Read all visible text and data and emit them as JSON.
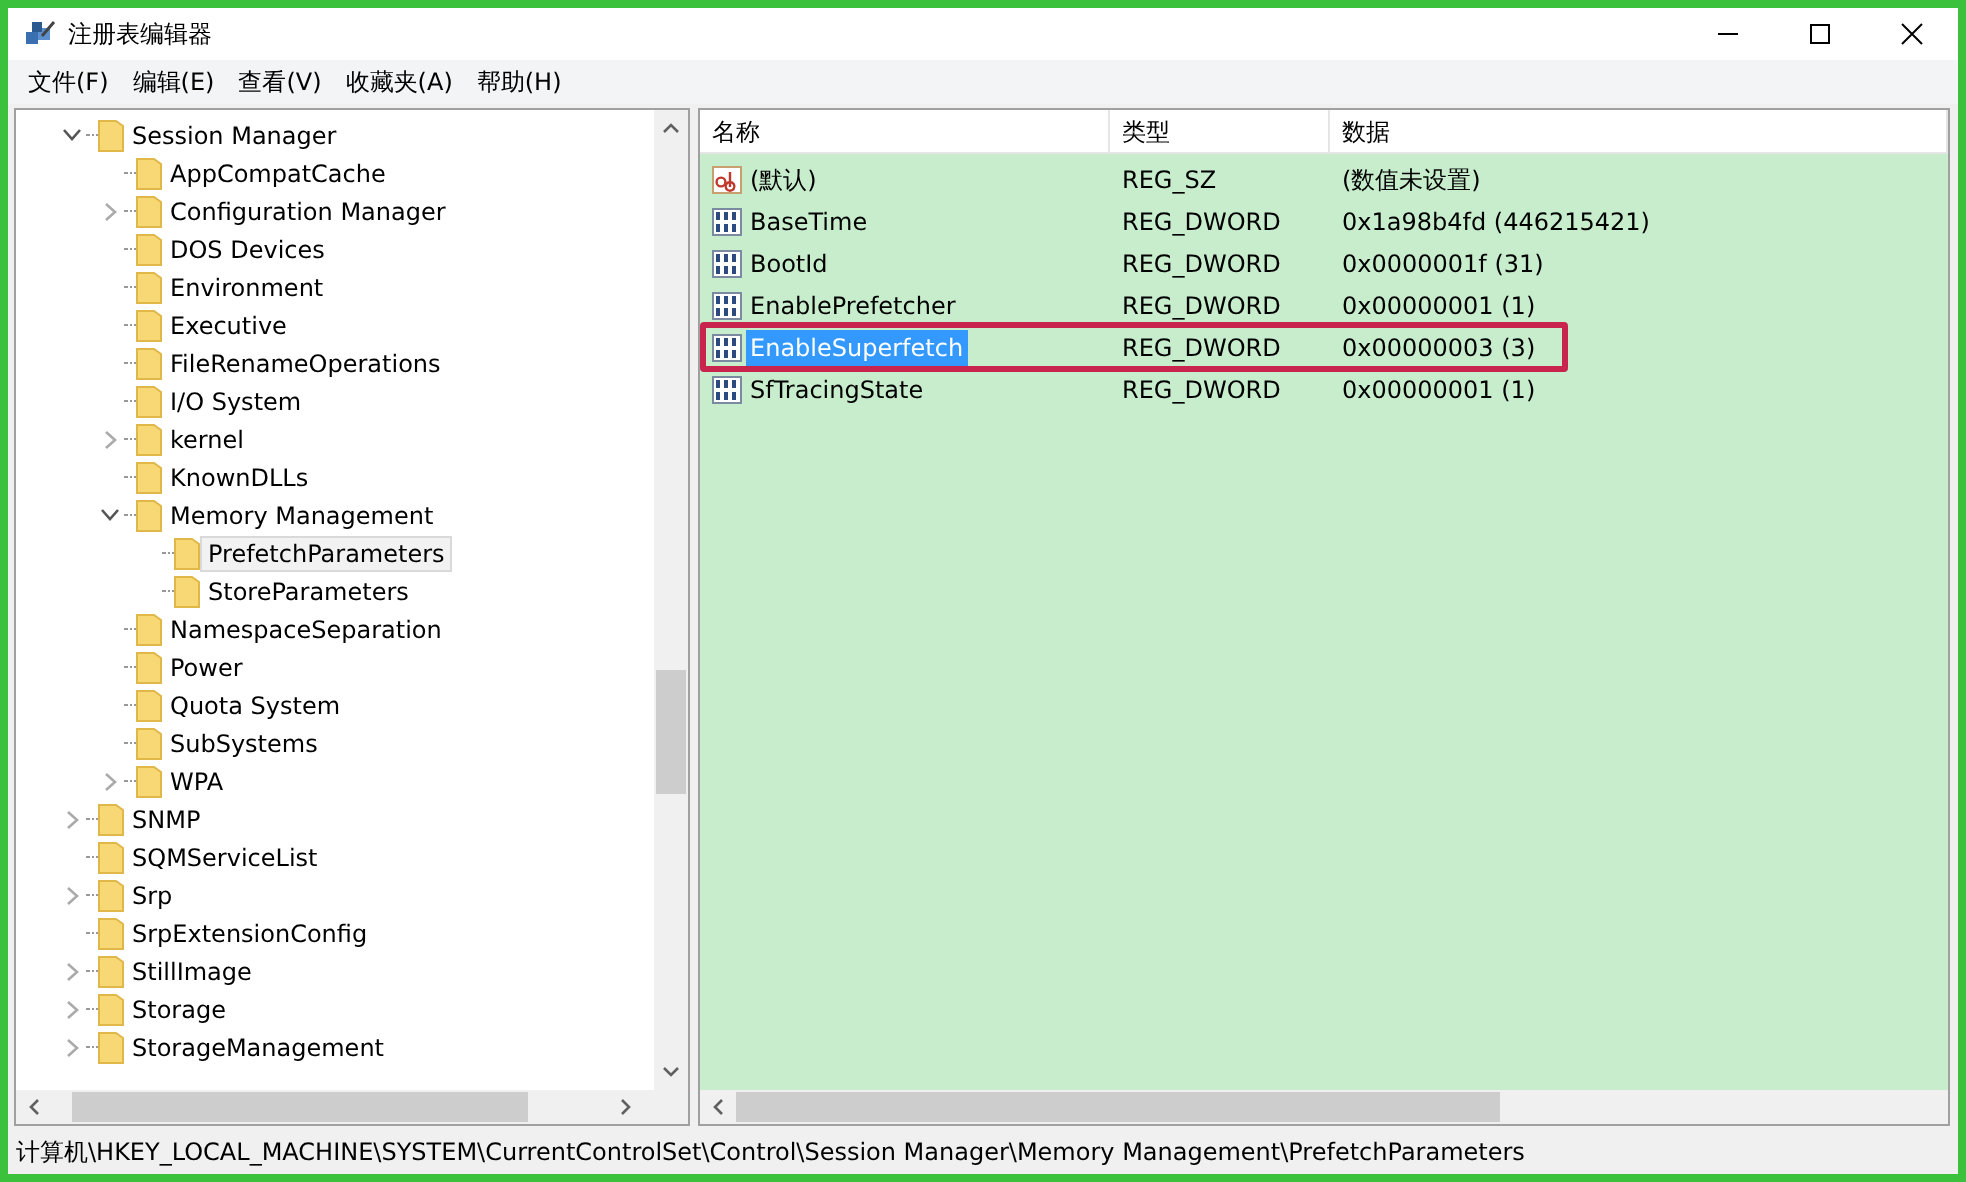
{
  "window": {
    "title": "注册表编辑器"
  },
  "menu": [
    "文件(F)",
    "编辑(E)",
    "查看(V)",
    "收藏夹(A)",
    "帮助(H)"
  ],
  "tree": [
    {
      "label": "Session Manager",
      "expanded": true,
      "selected": false,
      "children": [
        {
          "label": "AppCompatCache",
          "selected": false
        },
        {
          "label": "Configuration Manager",
          "expanded": false,
          "selected": false
        },
        {
          "label": "DOS Devices",
          "selected": false
        },
        {
          "label": "Environment",
          "selected": false
        },
        {
          "label": "Executive",
          "selected": false
        },
        {
          "label": "FileRenameOperations",
          "selected": false
        },
        {
          "label": "I/O System",
          "selected": false
        },
        {
          "label": "kernel",
          "expanded": false,
          "selected": false
        },
        {
          "label": "KnownDLLs",
          "selected": false
        },
        {
          "label": "Memory Management",
          "expanded": true,
          "selected": false,
          "children": [
            {
              "label": "PrefetchParameters",
              "selected": true
            },
            {
              "label": "StoreParameters",
              "selected": false
            }
          ]
        },
        {
          "label": "NamespaceSeparation",
          "selected": false
        },
        {
          "label": "Power",
          "selected": false
        },
        {
          "label": "Quota System",
          "selected": false
        },
        {
          "label": "SubSystems",
          "selected": false
        },
        {
          "label": "WPA",
          "expanded": false,
          "selected": false
        }
      ]
    },
    {
      "label": "SNMP",
      "expanded": false,
      "selected": false
    },
    {
      "label": "SQMServiceList",
      "selected": false
    },
    {
      "label": "Srp",
      "expanded": false,
      "selected": false
    },
    {
      "label": "SrpExtensionConfig",
      "selected": false
    },
    {
      "label": "StillImage",
      "expanded": false,
      "selected": false
    },
    {
      "label": "Storage",
      "expanded": false,
      "selected": false
    },
    {
      "label": "StorageManagement",
      "expanded": false,
      "selected": false
    }
  ],
  "values": {
    "columns": [
      "名称",
      "类型",
      "数据"
    ],
    "rows": [
      {
        "kind": "string",
        "name": "(默认)",
        "type": "REG_SZ",
        "data": "(数值未设置)",
        "selected": false,
        "highlighted": false
      },
      {
        "kind": "dword",
        "name": "BaseTime",
        "type": "REG_DWORD",
        "data": "0x1a98b4fd (446215421)",
        "selected": false,
        "highlighted": false
      },
      {
        "kind": "dword",
        "name": "BootId",
        "type": "REG_DWORD",
        "data": "0x0000001f (31)",
        "selected": false,
        "highlighted": false
      },
      {
        "kind": "dword",
        "name": "EnablePrefetcher",
        "type": "REG_DWORD",
        "data": "0x00000001 (1)",
        "selected": false,
        "highlighted": false
      },
      {
        "kind": "dword",
        "name": "EnableSuperfetch",
        "type": "REG_DWORD",
        "data": "0x00000003 (3)",
        "selected": true,
        "highlighted": true
      },
      {
        "kind": "dword",
        "name": "SfTracingState",
        "type": "REG_DWORD",
        "data": "0x00000001 (1)",
        "selected": false,
        "highlighted": false
      }
    ]
  },
  "status_bar": "计算机\\HKEY_LOCAL_MACHINE\\SYSTEM\\CurrentControlSet\\Control\\Session Manager\\Memory Management\\PrefetchParameters"
}
